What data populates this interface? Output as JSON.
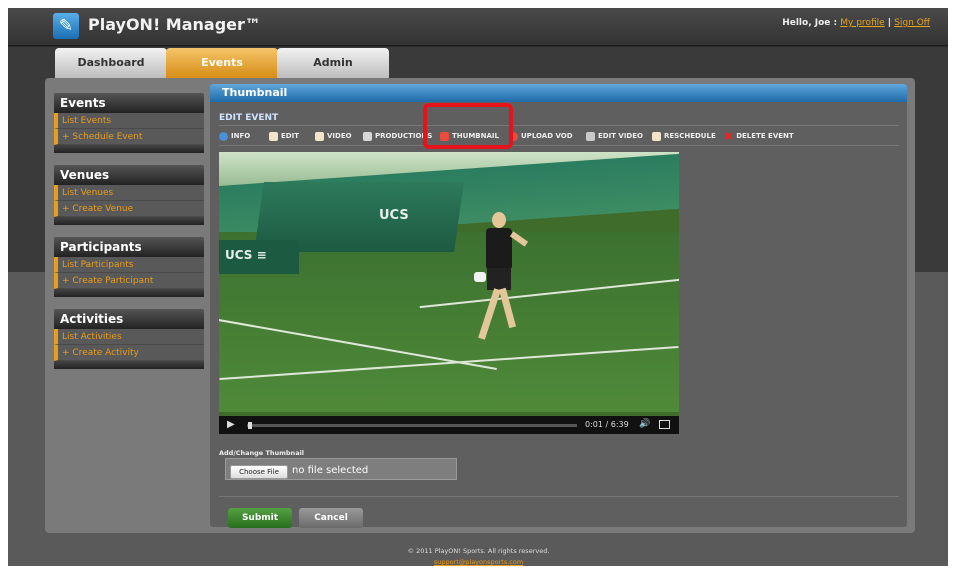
{
  "header": {
    "logo_glyph": "✎",
    "app_title": "PlayON! Manager™",
    "greeting": "Hello, Joe :",
    "my_profile": "My profile",
    "separator": " | ",
    "sign_out": "Sign Off"
  },
  "tabs": [
    {
      "label": "Dashboard",
      "active": false
    },
    {
      "label": "Events",
      "active": true
    },
    {
      "label": "Admin",
      "active": false
    }
  ],
  "sidebar": [
    {
      "title": "Events",
      "items": [
        "List Events",
        "+ Schedule Event"
      ]
    },
    {
      "title": "Venues",
      "items": [
        "List Venues",
        "+ Create Venue"
      ]
    },
    {
      "title": "Participants",
      "items": [
        "List Participants",
        "+ Create Participant"
      ]
    },
    {
      "title": "Activities",
      "items": [
        "List Activities",
        "+ Create Activity"
      ]
    }
  ],
  "content": {
    "section_title": "Thumbnail",
    "edit_event_label": "EDIT EVENT",
    "toolbar": [
      {
        "label": "INFO",
        "icon": "info-icon",
        "color": "#4a90d9"
      },
      {
        "label": "EDIT",
        "icon": "document-icon",
        "color": "#f2e6c8"
      },
      {
        "label": "VIDEO",
        "icon": "video-file-icon",
        "color": "#f2e6c8"
      },
      {
        "label": "PRODUCTIONS",
        "icon": "folder-icon",
        "color": "#d8d8d8"
      },
      {
        "label": "THUMBNAIL",
        "icon": "thumbnail-icon",
        "color": "#e94b3c"
      },
      {
        "label": "UPLOAD VOD",
        "icon": "upload-icon",
        "color": "#e94b3c"
      },
      {
        "label": "EDIT VIDEO",
        "icon": "scissors-icon",
        "color": "#c9c9c9"
      },
      {
        "label": "RESCHEDULE",
        "icon": "calendar-icon",
        "color": "#f2e6c8"
      },
      {
        "label": "DELETE EVENT",
        "icon": "delete-icon",
        "color": "#e22"
      }
    ],
    "video": {
      "tent_text": "UCS",
      "wall_text": "UCS ≡",
      "play_glyph": "▶",
      "time": "0:01 / 6:39",
      "volume_glyph": "🔊",
      "progress": 0.003
    },
    "thumbnail_field": {
      "label": "Add/Change Thumbnail",
      "button": "Choose File",
      "value": "no file selected"
    },
    "submit_label": "Submit",
    "cancel_label": "Cancel"
  },
  "footer": {
    "copyright": "© 2011 PlayON! Sports. All rights reserved.",
    "support_email": "support@playonsports.com"
  },
  "colors": {
    "accent_orange": "#e89d1c",
    "header_blue": "#1f6aa8",
    "highlight_red": "#e6141a",
    "submit_green": "#3e8a2f"
  }
}
